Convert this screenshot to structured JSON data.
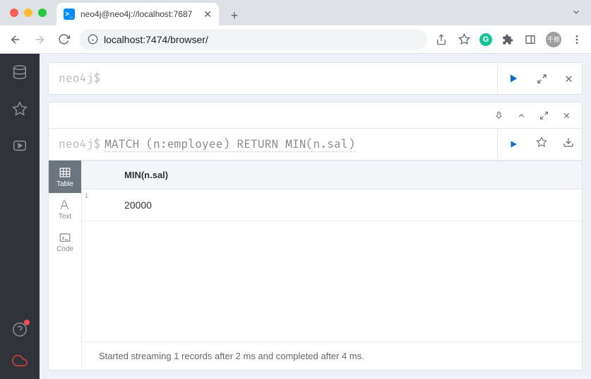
{
  "browser": {
    "tab_title": "neo4j@neo4j://localhost:7687",
    "url": "localhost:7474/browser/",
    "avatar_text": "千郎"
  },
  "editor": {
    "prompt": "neo4j$",
    "query": ""
  },
  "frame": {
    "prompt": "neo4j$",
    "query": "MATCH (n:employee) RETURN MIN(n.sal)"
  },
  "views": {
    "table": "Table",
    "text": "Text",
    "code": "Code"
  },
  "result": {
    "columns": [
      "MIN(n.sal)"
    ],
    "rows": [
      {
        "idx": "1",
        "cells": [
          "20000"
        ]
      }
    ]
  },
  "status": "Started streaming 1 records after 2 ms and completed after 4 ms."
}
